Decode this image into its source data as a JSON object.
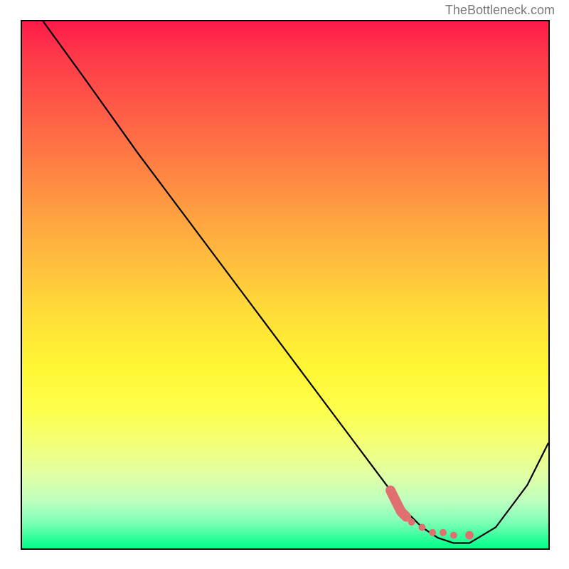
{
  "watermark": "TheBottleneck.com",
  "chart_data": {
    "type": "line",
    "title": "",
    "xlabel": "",
    "ylabel": "",
    "xlim": [
      0,
      100
    ],
    "ylim": [
      0,
      100
    ],
    "grid": false,
    "legend": false,
    "series": [
      {
        "name": "bottleneck-curve",
        "x": [
          4,
          12,
          22,
          28,
          34,
          40,
          46,
          52,
          58,
          64,
          70,
          73,
          76,
          79,
          82,
          85,
          90,
          96,
          100
        ],
        "y": [
          100,
          89,
          75,
          67,
          59,
          51,
          43,
          35,
          27,
          19,
          11,
          7,
          4,
          2,
          1,
          1,
          4,
          12,
          20
        ],
        "color": "#000000"
      }
    ],
    "markers": [
      {
        "name": "highlight-segment",
        "x": [
          70,
          71,
          72,
          73,
          74,
          76,
          78,
          80,
          82,
          85
        ],
        "y": [
          11,
          9,
          7,
          6,
          5,
          4,
          3,
          3,
          2.5,
          2.5
        ],
        "color": "#e07070",
        "style": "thick-dotted"
      }
    ],
    "background": {
      "type": "vertical-gradient",
      "stops": [
        {
          "pos": 0,
          "color": "#ff1a4a"
        },
        {
          "pos": 50,
          "color": "#ffd038"
        },
        {
          "pos": 80,
          "color": "#faff50"
        },
        {
          "pos": 100,
          "color": "#00ff88"
        }
      ]
    }
  }
}
